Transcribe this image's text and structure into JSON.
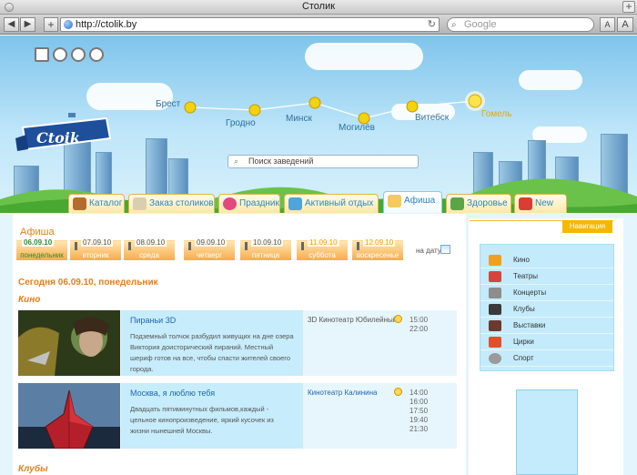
{
  "window": {
    "title": "Столик"
  },
  "toolbar": {
    "url": "http://ctolik.by",
    "search_placeholder": "Google",
    "back": "◀",
    "forward": "▶",
    "add": "+",
    "font_small": "A",
    "font_large": "A"
  },
  "header": {
    "logo_text": "Ctoik",
    "search_placeholder": "Поиск заведений",
    "cities": [
      "Брест",
      "Гродно",
      "Минск",
      "Могилёв",
      "Витебск",
      "Гомель"
    ],
    "active_city": "Гомель"
  },
  "nav_tabs": [
    {
      "label": "Каталог"
    },
    {
      "label": "Заказ столиков"
    },
    {
      "label": "Праздник"
    },
    {
      "label": "Активный отдых"
    },
    {
      "label": "Афиша",
      "active": true
    },
    {
      "label": "Здоровье"
    },
    {
      "label": "New"
    }
  ],
  "afisha": {
    "title": "Афиша",
    "by_date_label": "на дату",
    "days": [
      {
        "date": "06.09.10",
        "weekday": "понедельник",
        "current": true
      },
      {
        "date": "07.09.10",
        "weekday": "вторник"
      },
      {
        "date": "08.09.10",
        "weekday": "среда"
      },
      {
        "date": "09.09.10",
        "weekday": "четверг"
      },
      {
        "date": "10.09.10",
        "weekday": "пятница"
      },
      {
        "date": "11.09.10",
        "weekday": "суббота",
        "weekend": true
      },
      {
        "date": "12.09.10",
        "weekday": "воскресенье",
        "weekend": true
      }
    ],
    "today_label": "Сегодня 06.09.10, понедельник",
    "sections": {
      "cinema": "Кино",
      "clubs": "Клубы"
    },
    "events": [
      {
        "title": "Пираньи 3D",
        "text": "Подземный толчок разбудил живущих на дне озера Виктория доисторический пираний. Местный шериф готов на все, чтобы спасти жителей своего города.",
        "venue": "3D Кинотеатр Юбилейный",
        "times": [
          "15:00",
          "22:00"
        ]
      },
      {
        "title": "Москва, я люблю тебя",
        "text": "Двадцать пятиминутных фильмов,каждый - цельное кинопроизведение, яркий кусочек из жизни нынешней Москвы.",
        "venue": "Кинотеатр Калинина",
        "times": [
          "14:00",
          "16:00",
          "17:50",
          "19:40",
          "21:30"
        ]
      }
    ]
  },
  "sidebar": {
    "title": "Навигация",
    "items": [
      {
        "label": "Кино",
        "color": "#f0a020"
      },
      {
        "label": "Театры",
        "color": "#d8433e"
      },
      {
        "label": "Концерты",
        "color": "#8d8d8d"
      },
      {
        "label": "Клубы",
        "color": "#3b3b3b"
      },
      {
        "label": "Выставки",
        "color": "#6a3a2e"
      },
      {
        "label": "Цирки",
        "color": "#e2502a"
      },
      {
        "label": "Спорт",
        "color": "#9a9a9a"
      }
    ]
  },
  "colors": {
    "accent": "#e1801d",
    "link": "#1f67ad",
    "panel": "#c4ebfb",
    "tab_gold": "#f4b800"
  }
}
